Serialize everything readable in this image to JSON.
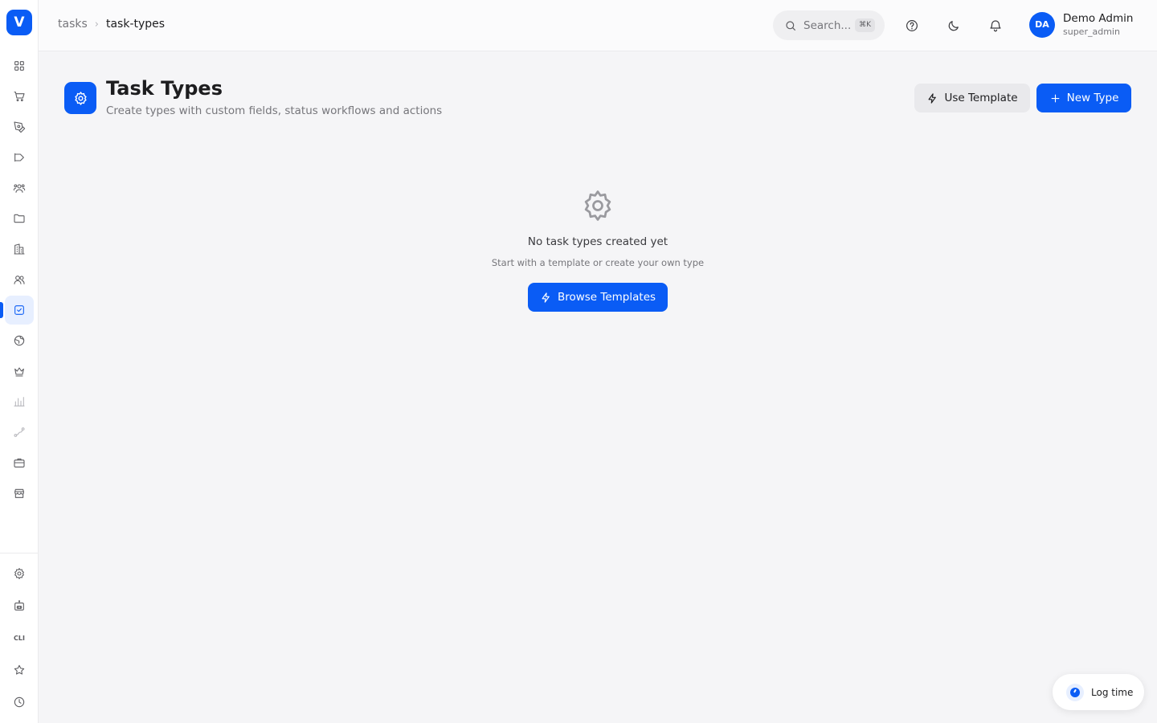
{
  "app": {
    "logo_letter": "V"
  },
  "sidebar": {
    "items": [
      {
        "id": "dashboard",
        "icon": "grid-icon"
      },
      {
        "id": "shop",
        "icon": "cart-icon"
      },
      {
        "id": "design",
        "icon": "pen-tool-icon"
      },
      {
        "id": "campaigns",
        "icon": "megaphone-icon"
      },
      {
        "id": "people",
        "icon": "users-icon"
      },
      {
        "id": "files",
        "icon": "folder-icon"
      },
      {
        "id": "companies",
        "icon": "building-icon"
      },
      {
        "id": "teams",
        "icon": "team-icon"
      },
      {
        "id": "tasks",
        "icon": "checkbox-icon",
        "active": true
      },
      {
        "id": "globe",
        "icon": "globe-icon"
      },
      {
        "id": "premium",
        "icon": "crown-icon"
      },
      {
        "id": "analytics",
        "icon": "bar-chart-icon"
      },
      {
        "id": "routes",
        "icon": "route-icon"
      },
      {
        "id": "jobs",
        "icon": "briefcase-icon"
      },
      {
        "id": "store",
        "icon": "store-icon"
      }
    ],
    "bottom_items": [
      {
        "id": "settings",
        "icon": "gear-icon"
      },
      {
        "id": "bot",
        "icon": "robot-icon"
      },
      {
        "id": "cli",
        "label": "CLI"
      },
      {
        "id": "favorites",
        "icon": "star-icon"
      },
      {
        "id": "history",
        "icon": "clock-icon"
      }
    ]
  },
  "topbar": {
    "breadcrumb": {
      "parent": "tasks",
      "current": "task-types"
    },
    "search": {
      "placeholder": "Search...",
      "shortcut": "⌘K"
    },
    "user": {
      "initials": "DA",
      "name": "Demo Admin",
      "role": "super_admin"
    }
  },
  "page": {
    "title": "Task Types",
    "subtitle": "Create types with custom fields, status workflows and actions",
    "use_template_label": "Use Template",
    "new_type_label": "New Type"
  },
  "empty_state": {
    "title": "No task types created yet",
    "subtitle": "Start with a template or create your own type",
    "button_label": "Browse Templates"
  },
  "log_time": {
    "label": "Log time"
  },
  "colors": {
    "accent": "#0a5cf5",
    "background": "#f5f5f7"
  }
}
